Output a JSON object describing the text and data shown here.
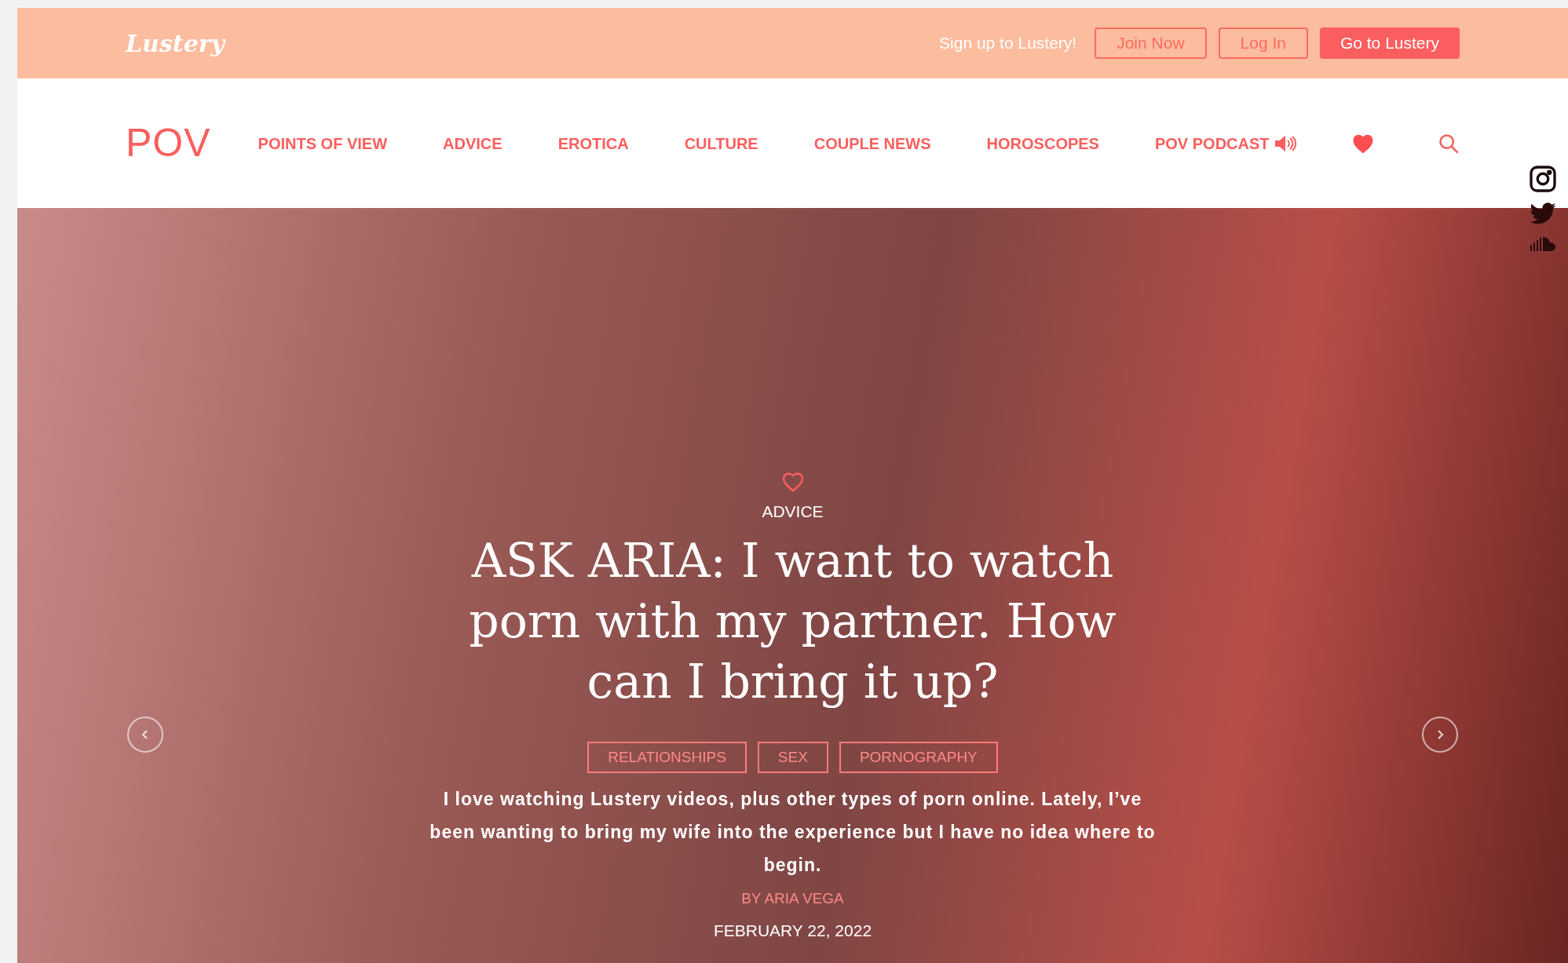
{
  "banner": {
    "logo": "Lustery",
    "signup_text": "Sign up to Lustery!",
    "buttons": [
      {
        "label": "Join Now",
        "kind": "outline"
      },
      {
        "label": "Log In",
        "kind": "outline"
      },
      {
        "label": "Go to Lustery",
        "kind": "filled"
      }
    ]
  },
  "nav": {
    "logo": "POV",
    "links": [
      {
        "label": "POINTS OF VIEW",
        "kind": "text"
      },
      {
        "label": "ADVICE",
        "kind": "text"
      },
      {
        "label": "EROTICA",
        "kind": "text"
      },
      {
        "label": "CULTURE",
        "kind": "text"
      },
      {
        "label": "COUPLE NEWS",
        "kind": "text"
      },
      {
        "label": "HOROSCOPES",
        "kind": "text"
      },
      {
        "label": "POV PODCAST",
        "kind": "podcast"
      }
    ]
  },
  "hero": {
    "category": "ADVICE",
    "title": "ASK ARIA: I want to watch porn with my partner. How can I bring it up?",
    "tags": [
      "RELATIONSHIPS",
      "SEX",
      "PORNOGRAPHY"
    ],
    "excerpt": "I love watching Lustery videos, plus other types of porn online. Lately, I’ve been wanting to bring my wife into the experience but I have no idea where to begin.",
    "author": "BY ARIA VEGA",
    "date": "FEBRUARY 22, 2022"
  }
}
